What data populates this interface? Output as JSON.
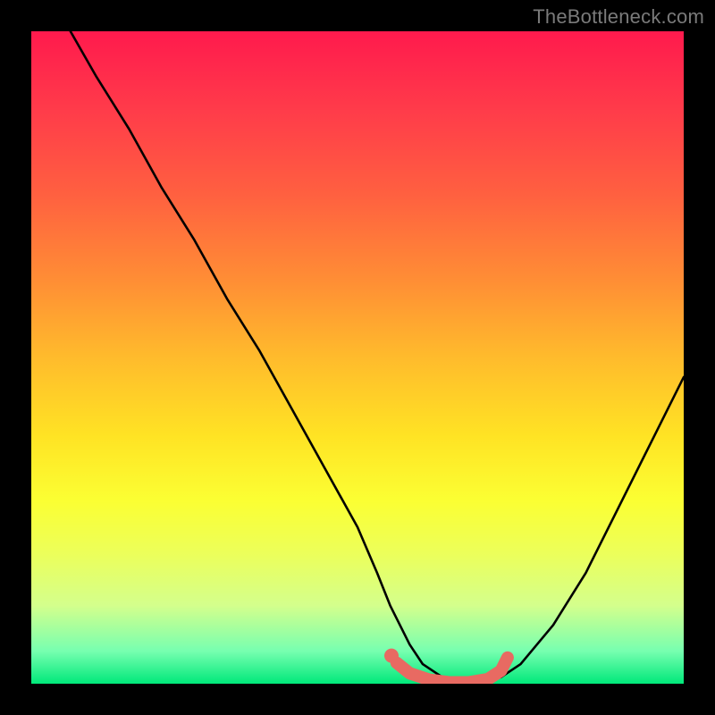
{
  "watermark": "TheBottleneck.com",
  "colors": {
    "background": "#000000",
    "curve": "#000000",
    "marker": "#e86a62",
    "gradient_top": "#ff1a4d",
    "gradient_bottom": "#00e87a"
  },
  "chart_data": {
    "type": "line",
    "title": "",
    "xlabel": "",
    "ylabel": "",
    "xlim": [
      0,
      100
    ],
    "ylim": [
      0,
      100
    ],
    "grid": false,
    "series": [
      {
        "name": "bottleneck-curve",
        "x": [
          6,
          10,
          15,
          20,
          25,
          30,
          35,
          40,
          45,
          50,
          53,
          55,
          58,
          60,
          63,
          66,
          69,
          72,
          75,
          80,
          85,
          90,
          95,
          100
        ],
        "values": [
          100,
          93,
          85,
          76,
          68,
          59,
          51,
          42,
          33,
          24,
          17,
          12,
          6,
          3,
          1,
          0,
          0,
          1,
          3,
          9,
          17,
          27,
          37,
          47
        ]
      }
    ],
    "annotations": [
      {
        "name": "optimal-range-marker",
        "type": "path",
        "color": "#e86a62",
        "x": [
          56,
          58,
          61,
          64,
          67,
          70,
          72,
          73
        ],
        "values": [
          3.2,
          1.6,
          0.6,
          0.2,
          0.2,
          0.7,
          2.0,
          4.0
        ]
      },
      {
        "name": "optimal-start-dot",
        "type": "point",
        "color": "#e86a62",
        "x": 55.2,
        "value": 4.3
      }
    ]
  }
}
